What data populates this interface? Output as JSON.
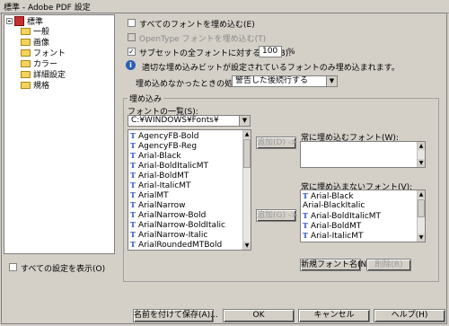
{
  "window": {
    "title": "標準 - Adobe PDF 設定"
  },
  "tree": {
    "root": "標準",
    "items": [
      "一般",
      "画像",
      "フォント",
      "カラー",
      "詳細設定",
      "規格"
    ]
  },
  "show_all_settings": "すべての設定を表示(O)",
  "options": {
    "embed_all": "すべてのフォントを埋め込む(E)",
    "embed_opentype": "OpenType フォントを埋め込む(T)",
    "subset_label": "サブセットの全フォントに対する割合(B):",
    "subset_value": "100",
    "subset_unit": "%",
    "info_text": "適切な埋め込みビットが設定されているフォントのみ埋め込まれます。",
    "fail_label": "埋め込めなかったときの処理(F):",
    "fail_value": "警告した後続行する"
  },
  "embed_group": {
    "title": "埋め込み",
    "font_list_label": "フォントの一覧(S):",
    "font_dir": "C:¥WINDOWS¥Fonts¥",
    "fonts": [
      "AgencyFB-Bold",
      "AgencyFB-Reg",
      "Arial-Black",
      "Arial-BoldItalicMT",
      "Arial-BoldMT",
      "Arial-ItalicMT",
      "ArialMT",
      "ArialNarrow",
      "ArialNarrow-Bold",
      "ArialNarrow-BoldItalic",
      "ArialNarrow-Italic",
      "ArialRoundedMTBold"
    ],
    "add_always_embed": "追加(D) ->",
    "add_never_embed": "追加(G) ->",
    "always_embed_label": "常に埋め込むフォント(W):",
    "never_embed_label": "常に埋め込まないフォント(V):",
    "never_embed_fonts": [
      {
        "name": "Arial-Black",
        "icon": true
      },
      {
        "name": "Arial-BlackItalic",
        "icon": false
      },
      {
        "name": "Arial-BoldItalicMT",
        "icon": true
      },
      {
        "name": "Arial-BoldMT",
        "icon": true
      },
      {
        "name": "Arial-ItalicMT",
        "icon": true
      }
    ],
    "new_font_name": "新規フォント名(N)...",
    "remove": "削除(R)"
  },
  "buttons": {
    "save_as": "名前を付けて保存(A)...",
    "ok": "OK",
    "cancel": "キャンセル",
    "help": "ヘルプ(H)"
  }
}
